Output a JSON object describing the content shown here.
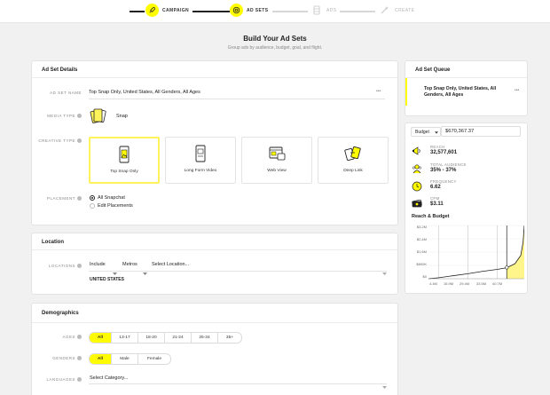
{
  "stepper": {
    "steps": [
      {
        "label": "CAMPAIGN",
        "state": "done",
        "icon": "rocket-icon"
      },
      {
        "label": "AD SETS",
        "state": "active",
        "icon": "target-icon"
      },
      {
        "label": "ADS",
        "state": "todo",
        "icon": "cards-icon"
      },
      {
        "label": "CREATE",
        "state": "todo",
        "icon": "wand-icon"
      }
    ]
  },
  "header": {
    "title": "Build Your Ad Sets",
    "subtitle": "Group ads by audience, budget, goal, and flight."
  },
  "ad_set_details": {
    "title": "Ad Set Details",
    "name_label": "AD SET NAME",
    "name_value": "Top Snap Only, United States, All Genders, All Ages",
    "more_glyph": "•••",
    "media_type_label": "MEDIA TYPE",
    "media_type_value": "Snap",
    "creative_type_label": "CREATIVE TYPE",
    "creative_types": [
      {
        "label": "Top Snap Only",
        "selected": true,
        "icon": "phone-image-icon"
      },
      {
        "label": "Long Form Video",
        "selected": false,
        "icon": "video-icon"
      },
      {
        "label": "Web View",
        "selected": false,
        "icon": "web-view-icon"
      },
      {
        "label": "Deep Link",
        "selected": false,
        "icon": "deep-link-icon"
      }
    ],
    "placement_label": "PLACEMENT",
    "placement_options": [
      "All Snapchat",
      "Edit Placements"
    ],
    "placement_selected": "All Snapchat"
  },
  "location": {
    "title": "Location",
    "label": "LOCATIONS",
    "include_value": "Include",
    "metros_value": "Metros",
    "select_placeholder": "Select Location...",
    "selected_location": "UNITED STATES"
  },
  "demographics": {
    "title": "Demographics",
    "ages_label": "AGES",
    "ages": [
      "All",
      "13-17",
      "18-20",
      "21-24",
      "25-34",
      "35+"
    ],
    "ages_selected": "All",
    "genders_label": "GENDERS",
    "genders": [
      "All",
      "Male",
      "Female"
    ],
    "genders_selected": "All",
    "languages_label": "LANGUAGES",
    "languages_placeholder": "Select Category..."
  },
  "queue": {
    "title": "Ad Set Queue",
    "item": "Top Snap Only, United States, All Genders, All Ages",
    "more_glyph": "•••"
  },
  "budget": {
    "type_label": "Budget",
    "amount": "$670,367.37",
    "stats": [
      {
        "label": "REACH",
        "value": "32,577,601",
        "icon": "megaphone-icon"
      },
      {
        "label": "TOTAL AUDIENCE",
        "value": "35% - 37%",
        "icon": "audience-icon"
      },
      {
        "label": "FREQUENCY",
        "value": "6.62",
        "icon": "clock-icon"
      },
      {
        "label": "CPM",
        "value": "$3.11",
        "icon": "money-icon"
      }
    ]
  },
  "chart_data": {
    "type": "area",
    "title": "Reach & Budget",
    "x_tick_labels": [
      "4.4M",
      "16.9M",
      "29.4M",
      "33.5M",
      "40.7M"
    ],
    "y_tick_labels": [
      "$3.2M",
      "$2.4M",
      "$1.6M",
      "$800K",
      "$0"
    ],
    "ylim": [
      0,
      3200000
    ],
    "xlim": [
      0,
      41000000
    ],
    "x": [
      0,
      4400000,
      10000000,
      16900000,
      23000000,
      29400000,
      33500000,
      37000000,
      39500000,
      40500000,
      41000000
    ],
    "y": [
      0,
      60000,
      170000,
      300000,
      440000,
      560000,
      660000,
      900000,
      1400000,
      2200000,
      3200000
    ],
    "marker": {
      "x": 33500000,
      "y": 670367
    },
    "grid": "vertical",
    "accent": "#fffc00",
    "fill": "#fff58a"
  }
}
